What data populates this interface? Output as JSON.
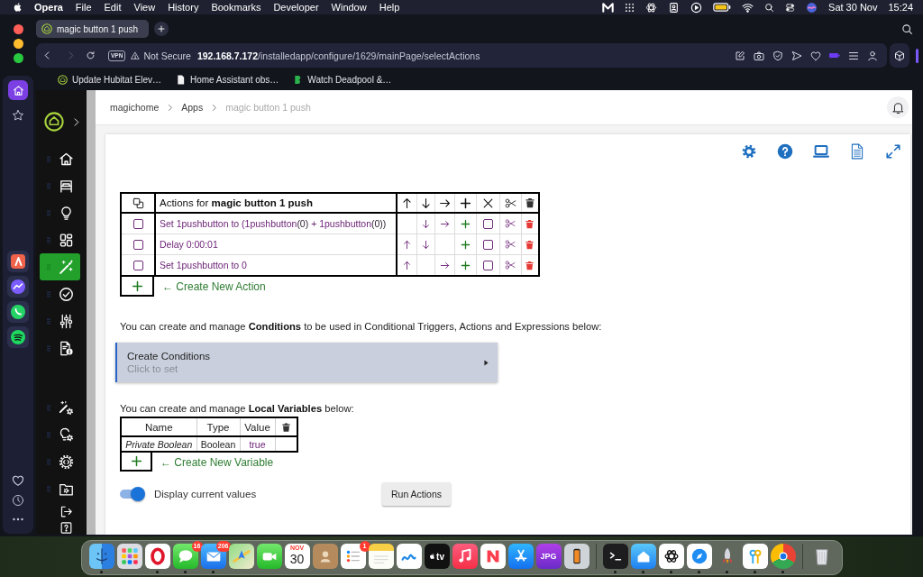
{
  "menu_bar": {
    "app_name": "Opera",
    "menus": [
      "File",
      "Edit",
      "View",
      "History",
      "Bookmarks",
      "Developer",
      "Window",
      "Help"
    ],
    "date": "Sat 30 Nov",
    "time": "15:24"
  },
  "browser": {
    "sidebar_apps": [
      {
        "kind": "aria"
      },
      {
        "kind": "messenger"
      },
      {
        "kind": "whatsapp"
      },
      {
        "kind": "spotify"
      }
    ],
    "tabs": [
      {
        "title": "magic button 1 push",
        "selected": true
      }
    ],
    "address_bar": {
      "vpn_badge": "VPN",
      "security": "Not Secure",
      "url": "**192.168.7.172**/installedapp/configure/1629/mainPage/selectActions"
    },
    "bookmarks": [
      {
        "kind": "hubitat",
        "title": "Update Hubitat Elev…"
      },
      {
        "kind": "page",
        "title": "Home Assistant obs…"
      },
      {
        "kind": "video",
        "title": "Watch Deadpool &…"
      }
    ]
  },
  "hub_sidebar": {
    "sections": [
      {
        "draggable": true,
        "items": [
          {
            "kind": "home",
            "selected": false
          },
          {
            "kind": "bed",
            "selected": false
          },
          {
            "kind": "bulb",
            "selected": false
          },
          {
            "kind": "grid",
            "selected": false
          },
          {
            "kind": "wand",
            "selected": true
          },
          {
            "kind": "check",
            "selected": false
          },
          {
            "kind": "sliders",
            "selected": false
          },
          {
            "kind": "doc_info",
            "selected": false
          }
        ]
      },
      {
        "draggable": true,
        "items": [
          {
            "kind": "wand_gear",
            "selected": false
          },
          {
            "kind": "bulb_gear",
            "selected": false
          },
          {
            "kind": "code_gear",
            "selected": false
          },
          {
            "kind": "folder_gear",
            "selected": false
          }
        ]
      },
      {
        "draggable": false,
        "items": [
          {
            "kind": "logout",
            "selected": false
          },
          {
            "kind": "help",
            "selected": false
          }
        ]
      }
    ]
  },
  "breadcrumb": [
    {
      "label": "magichome",
      "current": false
    },
    {
      "label": "Apps",
      "current": false
    },
    {
      "label": "magic button 1 push",
      "current": true
    }
  ],
  "actions_table": {
    "title": "Actions for **magic button 1 push**",
    "rows": [
      {
        "parts": [
          {
            "text": "Set 1pushbutton to (1pushbutton",
            "kind": "expr"
          },
          {
            "text": "(0)",
            "kind": "value"
          },
          {
            "text": " + 1pushbutton",
            "kind": "expr"
          },
          {
            "text": "(0))",
            "kind": "value"
          }
        ],
        "checked": false,
        "move_up": false,
        "move_down": true,
        "indent": true,
        "disable_checked": false
      },
      {
        "parts": [
          {
            "text": "Delay 0:00:01",
            "kind": "expr"
          }
        ],
        "checked": false,
        "move_up": true,
        "move_down": true,
        "indent": false,
        "disable_checked": false
      },
      {
        "parts": [
          {
            "text": "Set 1pushbutton to 0",
            "kind": "expr"
          }
        ],
        "checked": false,
        "move_up": true,
        "move_down": false,
        "indent": true,
        "disable_checked": false
      }
    ],
    "add_link": "← Create New Action"
  },
  "conditions_intro": "You can create and manage **Conditions** to be used in Conditional Triggers, Actions and Expressions below:",
  "conditions_panel": {
    "title": "Create Conditions",
    "hint": "Click to set"
  },
  "variables_intro": "You can create and manage **Local Variables** below:",
  "variables_table": {
    "columns": [
      "Name",
      "Type",
      "Value"
    ],
    "rows": [
      {
        "name": "Private Boolean",
        "type": "Boolean",
        "value": "true"
      }
    ],
    "add_link": "← Create New Variable"
  },
  "display_values": {
    "label": "Display current values",
    "on": true
  },
  "run_button": "Run Actions",
  "dock": {
    "groups": [
      {
        "apps": [
          {
            "kind": "finder",
            "running": true
          },
          {
            "kind": "launchpad",
            "running": false
          },
          {
            "kind": "opera",
            "running": true
          },
          {
            "kind": "messages",
            "running": true,
            "badge": "16"
          },
          {
            "kind": "mail",
            "running": true,
            "badge": "206"
          },
          {
            "kind": "maps",
            "running": false
          },
          {
            "kind": "facetime",
            "running": false
          },
          {
            "kind": "calendar",
            "running": false,
            "month": "NOV",
            "day": "30"
          },
          {
            "kind": "contacts",
            "running": false
          },
          {
            "kind": "reminders",
            "running": false,
            "badge": "1"
          },
          {
            "kind": "notes",
            "running": false
          },
          {
            "kind": "freeform",
            "running": false
          },
          {
            "kind": "tv",
            "running": false,
            "label": "tv"
          },
          {
            "kind": "music",
            "running": false
          },
          {
            "kind": "news",
            "running": false
          },
          {
            "kind": "app_store",
            "running": false
          },
          {
            "kind": "jpg",
            "running": false,
            "label": "JPG"
          },
          {
            "kind": "iphone_mirroring",
            "running": false
          }
        ]
      },
      {
        "apps": [
          {
            "kind": "terminal",
            "running": true
          },
          {
            "kind": "home",
            "running": true
          },
          {
            "kind": "chatgpt",
            "running": true
          },
          {
            "kind": "safari",
            "running": true
          },
          {
            "kind": "rocket",
            "running": true
          },
          {
            "kind": "passwords",
            "running": true
          },
          {
            "kind": "chrome",
            "running": true
          }
        ]
      },
      {
        "apps": [
          {
            "kind": "trash",
            "running": false
          }
        ]
      }
    ]
  }
}
